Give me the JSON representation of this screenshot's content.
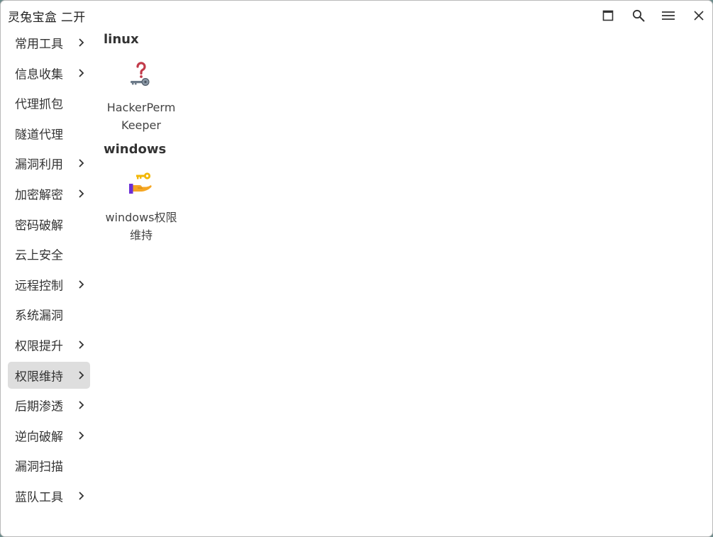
{
  "window": {
    "title": "灵兔宝盒 二开"
  },
  "titlebar": {
    "buttons": [
      {
        "name": "maximize",
        "icon": "maximize-icon"
      },
      {
        "name": "search",
        "icon": "search-icon"
      },
      {
        "name": "menu",
        "icon": "menu-icon"
      },
      {
        "name": "close",
        "icon": "close-icon"
      }
    ]
  },
  "sidebar": {
    "items": [
      {
        "label": "常用工具",
        "has_children": true
      },
      {
        "label": "信息收集",
        "has_children": true
      },
      {
        "label": "代理抓包",
        "has_children": false
      },
      {
        "label": "隧道代理",
        "has_children": false
      },
      {
        "label": "漏洞利用",
        "has_children": true
      },
      {
        "label": "加密解密",
        "has_children": true
      },
      {
        "label": "密码破解",
        "has_children": false
      },
      {
        "label": "云上安全",
        "has_children": false
      },
      {
        "label": "远程控制",
        "has_children": true
      },
      {
        "label": "系统漏洞",
        "has_children": false
      },
      {
        "label": "权限提升",
        "has_children": true
      },
      {
        "label": "权限维持",
        "has_children": true,
        "active": true
      },
      {
        "label": "后期渗透",
        "has_children": true
      },
      {
        "label": "逆向破解",
        "has_children": true
      },
      {
        "label": "漏洞扫描",
        "has_children": false
      },
      {
        "label": "蓝队工具",
        "has_children": true
      }
    ],
    "active_color": "#dedede"
  },
  "main": {
    "sections": [
      {
        "title": "linux",
        "apps": [
          {
            "name": "HackerPermKeeper",
            "icon": "question-key-icon"
          }
        ]
      },
      {
        "title": "windows",
        "apps": [
          {
            "name": "windows权限维持",
            "icon": "hand-key-icon"
          }
        ]
      }
    ]
  }
}
